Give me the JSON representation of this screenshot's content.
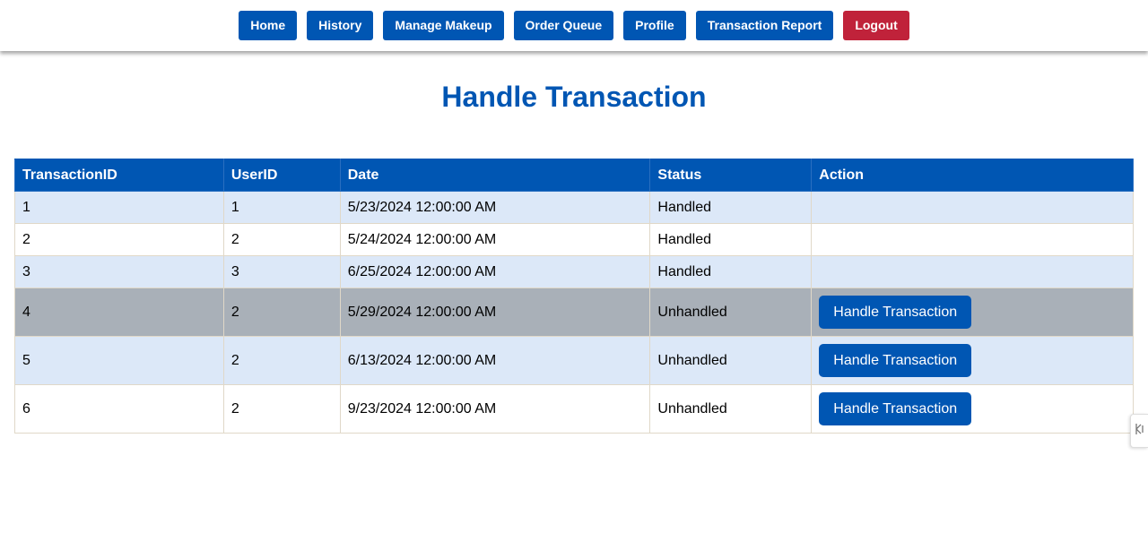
{
  "nav": {
    "items": [
      {
        "label": "Home",
        "name": "nav-home-button"
      },
      {
        "label": "History",
        "name": "nav-history-button"
      },
      {
        "label": "Manage Makeup",
        "name": "nav-manage-makeup-button"
      },
      {
        "label": "Order Queue",
        "name": "nav-order-queue-button"
      },
      {
        "label": "Profile",
        "name": "nav-profile-button"
      },
      {
        "label": "Transaction Report",
        "name": "nav-transaction-report-button"
      },
      {
        "label": "Logout",
        "name": "nav-logout-button"
      }
    ]
  },
  "page": {
    "title": "Handle Transaction"
  },
  "table": {
    "headers": [
      "TransactionID",
      "UserID",
      "Date",
      "Status",
      "Action"
    ],
    "rows": [
      {
        "transaction_id": "1",
        "user_id": "1",
        "date": "5/23/2024 12:00:00 AM",
        "status": "Handled",
        "action": ""
      },
      {
        "transaction_id": "2",
        "user_id": "2",
        "date": "5/24/2024 12:00:00 AM",
        "status": "Handled",
        "action": ""
      },
      {
        "transaction_id": "3",
        "user_id": "3",
        "date": "6/25/2024 12:00:00 AM",
        "status": "Handled",
        "action": ""
      },
      {
        "transaction_id": "4",
        "user_id": "2",
        "date": "5/29/2024 12:00:00 AM",
        "status": "Unhandled",
        "action": "Handle Transaction"
      },
      {
        "transaction_id": "5",
        "user_id": "2",
        "date": "6/13/2024 12:00:00 AM",
        "status": "Unhandled",
        "action": "Handle Transaction"
      },
      {
        "transaction_id": "6",
        "user_id": "2",
        "date": "9/23/2024 12:00:00 AM",
        "status": "Unhandled",
        "action": "Handle Transaction"
      }
    ]
  },
  "side_tab": {
    "icon": "collapse-icon"
  },
  "colors": {
    "primary": "#0056b3",
    "logout": "#c0223a",
    "row_alt": "#dce8f8",
    "row_hover": "#a9b0b8"
  }
}
